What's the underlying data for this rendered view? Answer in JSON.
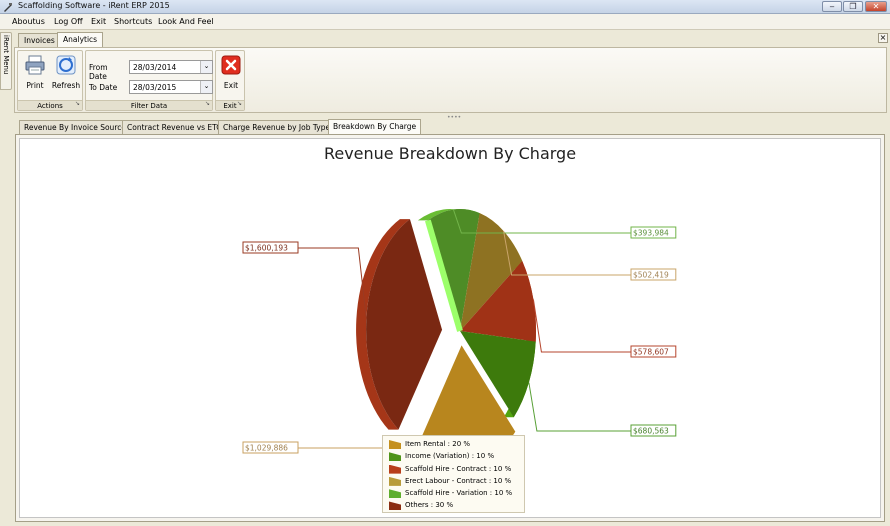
{
  "window": {
    "title": "Scaffolding Software - iRent ERP 2015",
    "minimize_glyph": "‒",
    "restore_glyph": "❐",
    "close_glyph": "✕"
  },
  "menu": [
    "Aboutus",
    "Log Off",
    "Exit",
    "Shortcuts",
    "Look And Feel"
  ],
  "side_panel": {
    "label": "iRent Menu"
  },
  "main_tabs": [
    {
      "label": "Invoices",
      "active": false
    },
    {
      "label": "Analytics",
      "active": true
    }
  ],
  "doc_close_glyph": "×",
  "ribbon": {
    "actions": {
      "label": "Actions",
      "print_label": "Print",
      "refresh_label": "Refresh"
    },
    "filter": {
      "label": "Filter Data",
      "from_label": "From Date",
      "from_value": "28/03/2014",
      "to_label": "To Date",
      "to_value": "28/03/2015",
      "dropdown_glyph": "⌄"
    },
    "exit": {
      "label": "Exit",
      "button_label": "Exit"
    }
  },
  "sub_tabs": [
    {
      "label": "Revenue By Invoice Source",
      "active": false
    },
    {
      "label": "Contract Revenue vs ETC",
      "active": false
    },
    {
      "label": "Charge Revenue by Job Type",
      "active": false
    },
    {
      "label": "Breakdown By Charge",
      "active": true
    }
  ],
  "chart_data": {
    "type": "pie",
    "title": "Revenue Breakdown By Charge",
    "slices": [
      {
        "legend": "Item Rental : 20 %",
        "percent": 20,
        "value_label": "$1,029,886",
        "color": "#b8861e"
      },
      {
        "legend": "Income (Variation) : 10 %",
        "percent": 10,
        "value_label": "$680,563",
        "color": "#3d7a0c"
      },
      {
        "legend": "Scaffold Hire  - Contract : 10 %",
        "percent": 10,
        "value_label": "$578,607",
        "color": "#a03216"
      },
      {
        "legend": "Erect Labour - Contract : 10 %",
        "percent": 10,
        "value_label": "$502,419",
        "color": "#8e7222"
      },
      {
        "legend": "Scaffold Hire  -  Variation : 10 %",
        "percent": 10,
        "value_label": "$393,984",
        "color": "#4e8c26"
      },
      {
        "legend": "Others : 30 %",
        "percent": 30,
        "value_label": "$1,600,193",
        "color": "#7a2812"
      }
    ],
    "legend_colors": [
      "#c4901e",
      "#4f9418",
      "#b83e1a",
      "#b89b3a",
      "#5fae2e",
      "#8a2e12"
    ],
    "label_border_colors": [
      "#c8a061",
      "#58a036",
      "#b6452c",
      "#c9a46a",
      "#72b44a",
      "#9a3a22"
    ],
    "legend_placement": "bottom-center"
  }
}
